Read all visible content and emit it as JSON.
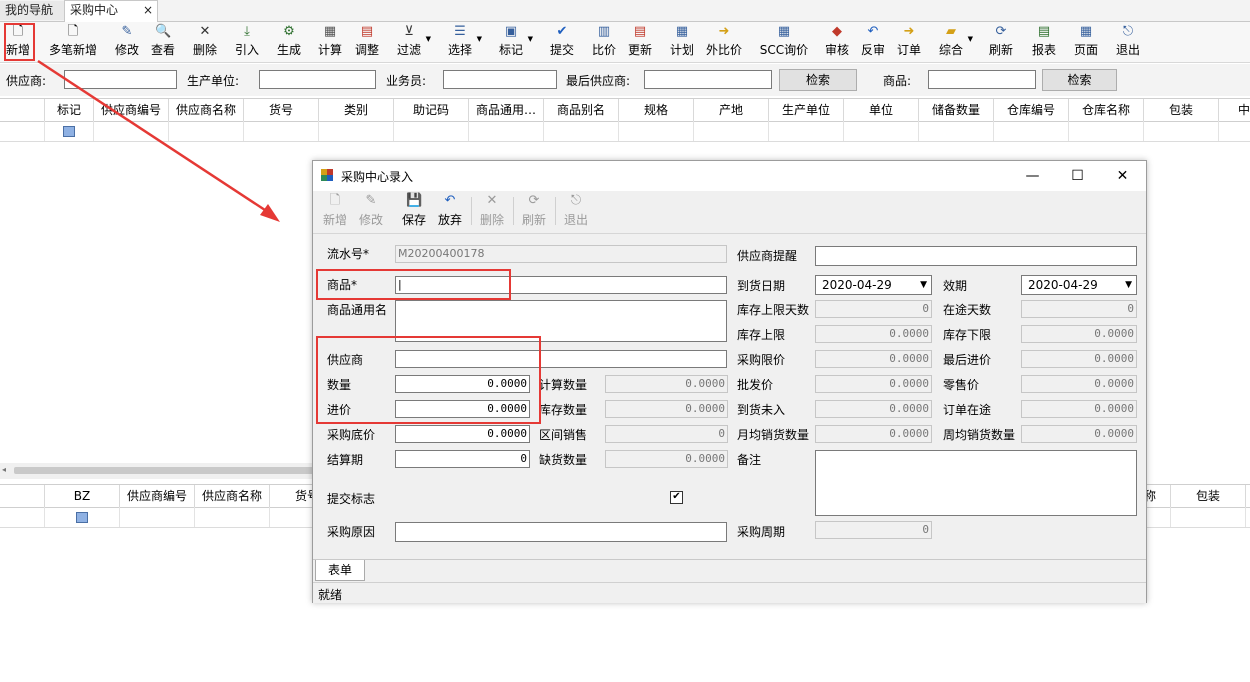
{
  "tabs": [
    {
      "label": "我的导航"
    },
    {
      "label": "采购中心",
      "close": "×"
    }
  ],
  "toolbar": [
    {
      "label": "新增",
      "icon": "new-doc-icon"
    },
    {
      "label": "多笔新增",
      "icon": "multi-new-icon"
    },
    {
      "label": "修改",
      "icon": "edit-icon"
    },
    {
      "label": "查看",
      "icon": "view-icon"
    },
    {
      "label": "删除",
      "icon": "delete-icon"
    },
    {
      "label": "引入",
      "icon": "import-icon"
    },
    {
      "label": "生成",
      "icon": "generate-icon"
    },
    {
      "label": "计算",
      "icon": "calculator-icon"
    },
    {
      "label": "调整",
      "icon": "adjust-icon"
    },
    {
      "label": "过滤",
      "icon": "filter-icon"
    },
    {
      "label": "选择",
      "icon": "select-icon"
    },
    {
      "label": "标记",
      "icon": "mark-icon"
    },
    {
      "label": "提交",
      "icon": "submit-icon"
    },
    {
      "label": "比价",
      "icon": "compare-price-icon"
    },
    {
      "label": "更新",
      "icon": "update-icon"
    },
    {
      "label": "计划",
      "icon": "plan-icon"
    },
    {
      "label": "外比价",
      "icon": "external-compare-icon"
    },
    {
      "label": "SCC询价",
      "icon": "scc-inquiry-icon"
    },
    {
      "label": "审核",
      "icon": "audit-icon"
    },
    {
      "label": "反审",
      "icon": "unaudit-icon"
    },
    {
      "label": "订单",
      "icon": "order-icon"
    },
    {
      "label": "综合",
      "icon": "summary-icon"
    },
    {
      "label": "刷新",
      "icon": "refresh-icon"
    },
    {
      "label": "报表",
      "icon": "report-icon"
    },
    {
      "label": "页面",
      "icon": "page-icon"
    },
    {
      "label": "退出",
      "icon": "exit-icon"
    }
  ],
  "search": {
    "supplier_label": "供应商:",
    "producer_label": "生产单位:",
    "salesman_label": "业务员:",
    "last_supplier_label": "最后供应商:",
    "search_button": "检索",
    "product_label": "商品:",
    "search_button2": "检索"
  },
  "top_grid": {
    "columns": [
      "标记",
      "供应商编号",
      "供应商名称",
      "货号",
      "类别",
      "助记码",
      "商品通用…",
      "商品别名",
      "规格",
      "产地",
      "生产单位",
      "单位",
      "储备数量",
      "仓库编号",
      "仓库名称",
      "包装",
      "中"
    ]
  },
  "bottom_grid": {
    "columns": [
      "BZ",
      "供应商编号",
      "供应商名称",
      "货号",
      "称",
      "包装"
    ]
  },
  "dialog": {
    "title": "采购中心录入",
    "window_buttons": {
      "minimize": "—",
      "maximize": "☐",
      "close": "✕"
    },
    "toolbar": [
      {
        "label": "新增",
        "enabled": false,
        "icon": "new-doc-icon"
      },
      {
        "label": "修改",
        "enabled": false,
        "icon": "edit-icon"
      },
      {
        "label": "保存",
        "enabled": true,
        "icon": "save-icon"
      },
      {
        "label": "放弃",
        "enabled": true,
        "icon": "undo-icon"
      },
      {
        "label": "删除",
        "enabled": false,
        "icon": "delete-icon"
      },
      {
        "label": "刷新",
        "enabled": false,
        "icon": "refresh-icon"
      },
      {
        "label": "退出",
        "enabled": false,
        "icon": "exit-icon"
      }
    ],
    "fields": {
      "serial_label": "流水号*",
      "serial_value": "M20200400178",
      "supplier_reminder_label": "供应商提醒",
      "supplier_reminder_value": "",
      "product_label": "商品*",
      "product_value": "|",
      "arrival_date_label": "到货日期",
      "arrival_date_value": "2020-04-29",
      "validity_label": "效期",
      "validity_value": "2020-04-29",
      "generic_name_label": "商品通用名",
      "stock_upper_days_label": "库存上限天数",
      "stock_upper_days_value": "0",
      "transit_days_label": "在途天数",
      "transit_days_value": "0",
      "stock_upper_label": "库存上限",
      "stock_upper_value": "0.0000",
      "stock_lower_label": "库存下限",
      "stock_lower_value": "0.0000",
      "supplier_label": "供应商",
      "supplier_value": "",
      "purchase_limit_label": "采购限价",
      "purchase_limit_value": "0.0000",
      "last_price_label": "最后进价",
      "last_price_value": "0.0000",
      "quantity_label": "数量",
      "quantity_value": "0.0000",
      "calc_qty_label": "计算数量",
      "calc_qty_value": "0.0000",
      "wholesale_label": "批发价",
      "wholesale_value": "0.0000",
      "retail_label": "零售价",
      "retail_value": "0.0000",
      "price_label": "进价",
      "price_value": "0.0000",
      "stock_qty_label": "库存数量",
      "stock_qty_value": "0.0000",
      "arrived_not_in_label": "到货未入",
      "arrived_not_in_value": "0.0000",
      "order_transit_label": "订单在途",
      "order_transit_value": "0.0000",
      "base_price_label": "采购底价",
      "base_price_value": "0.0000",
      "period_sales_label": "区间销售",
      "period_sales_value": "0",
      "monthly_avg_label": "月均销货数量",
      "monthly_avg_value": "0.0000",
      "weekly_avg_label": "周均销货数量",
      "weekly_avg_value": "0.0000",
      "settle_period_label": "结算期",
      "settle_period_value": "0",
      "shortage_label": "缺货数量",
      "shortage_value": "0.0000",
      "remark_label": "备注",
      "submit_flag_label": "提交标志",
      "submit_flag_checked": "✔",
      "reason_label": "采购原因",
      "reason_value": "",
      "cycle_label": "采购周期",
      "cycle_value": "0"
    },
    "tab_label": "表单",
    "status": "就绪"
  }
}
